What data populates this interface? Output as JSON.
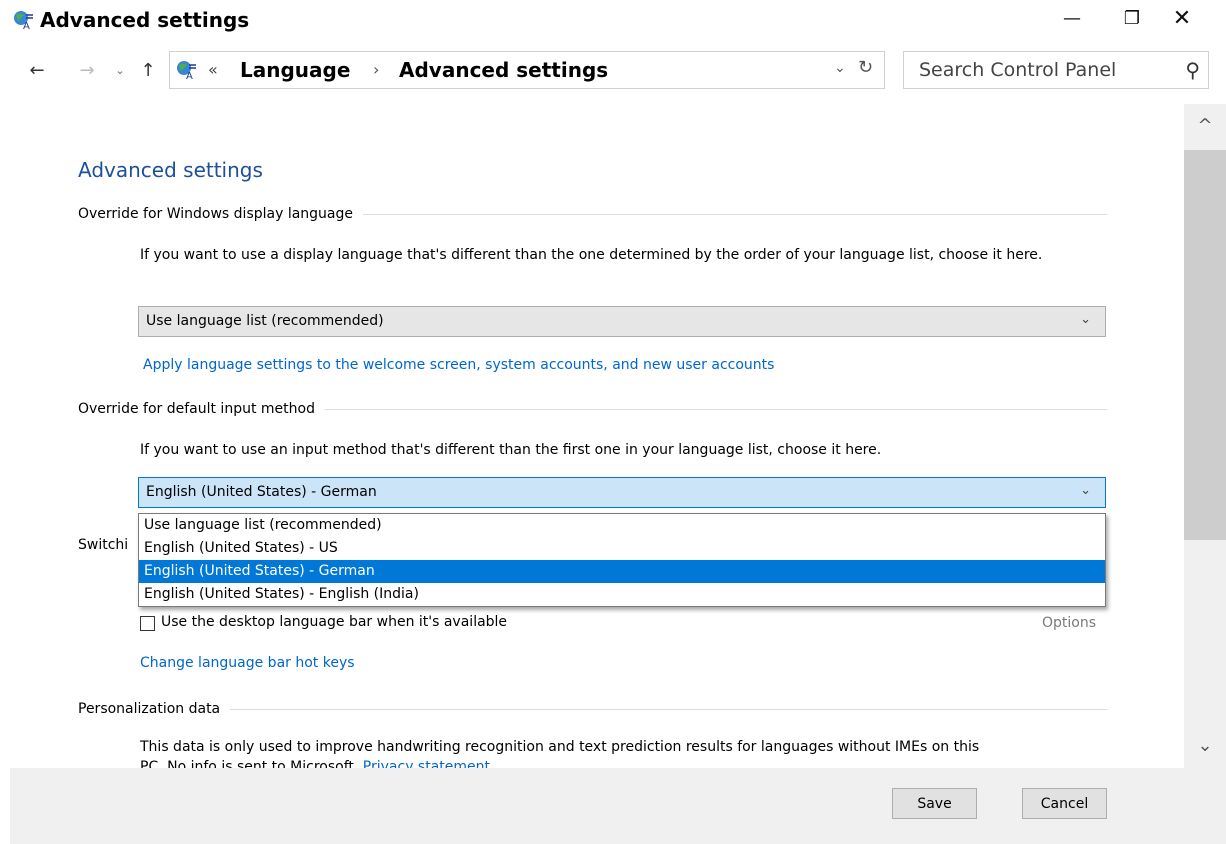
{
  "window": {
    "title": "Advanced settings",
    "minimize_glyph": "—",
    "maximize_glyph": "❐",
    "close_glyph": "✕"
  },
  "nav": {
    "back_glyph": "←",
    "forward_glyph": "→",
    "recent_glyph": "⌄",
    "up_glyph": "↑",
    "address": {
      "chevron": "«",
      "crumbs": [
        "Language",
        "Advanced settings"
      ],
      "separator": "›",
      "dropdown_glyph": "⌄",
      "refresh_glyph": "↻"
    },
    "search": {
      "placeholder": "Search Control Panel",
      "icon_glyph": "⚲"
    }
  },
  "content": {
    "page_title": "Advanced settings",
    "display_language": {
      "heading": "Override for Windows display language",
      "description": "If you want to use a display language that's different than the one determined by the order of your language list, choose it here.",
      "selected": "Use language list (recommended)",
      "link": "Apply language settings to the welcome screen, system accounts, and new user accounts"
    },
    "input_method": {
      "heading": "Override for default input method",
      "description": "If you want to use an input method that's different than the first one in your language list, choose it here.",
      "selected": "English (United States) - German",
      "options": [
        "Use language list (recommended)",
        "English (United States) - US",
        "English (United States) - German",
        "English (United States) - English (India)"
      ],
      "selected_index": 2
    },
    "switching": {
      "heading_visible": "Switchi",
      "checkbox_label": "Use the desktop language bar when it's available",
      "checkbox_checked": false,
      "options_link": "Options",
      "hotkeys_link": "Change language bar hot keys"
    },
    "personalization": {
      "heading": "Personalization data",
      "description_line1": "This data is only used to improve handwriting recognition and text prediction results for languages without IMEs on this",
      "description_line2": "PC. No info is sent to Microsoft. ",
      "privacy_link": "Privacy statement"
    }
  },
  "scrollbar": {
    "up_glyph": "^",
    "down_glyph": "⌄"
  },
  "footer": {
    "save_label": "Save",
    "cancel_label": "Cancel"
  },
  "colors": {
    "accent": "#0078d7",
    "link": "#0066cc",
    "title_blue": "#1e4f9c"
  }
}
